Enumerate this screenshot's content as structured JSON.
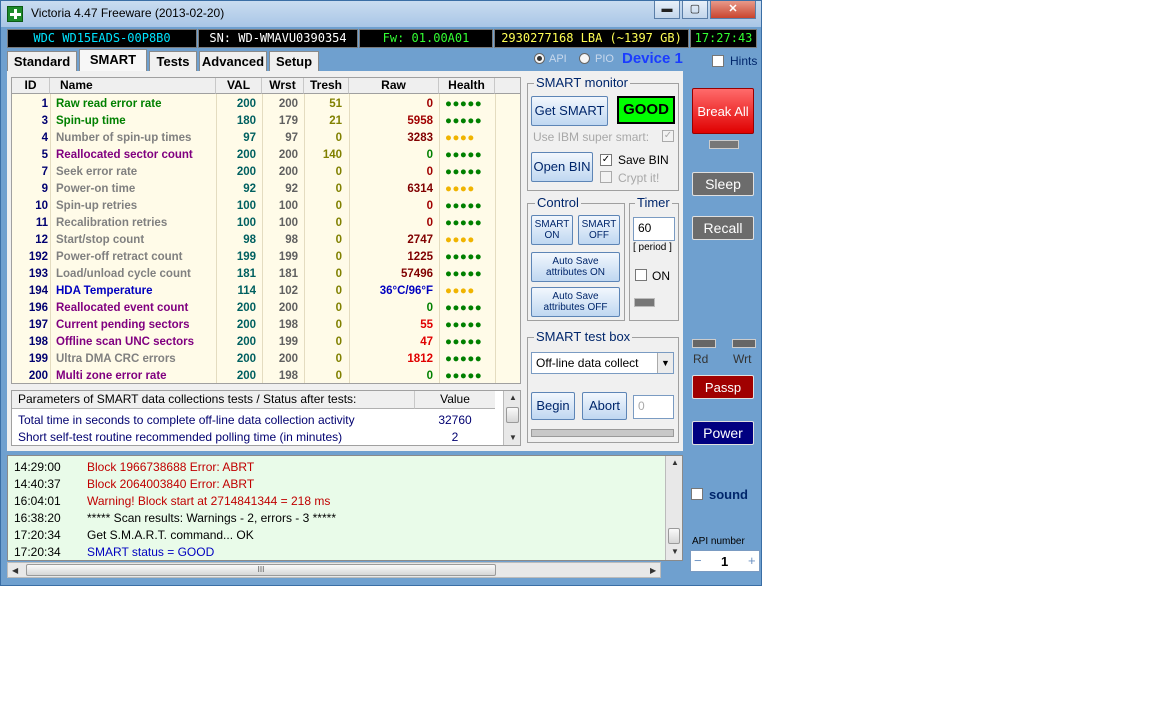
{
  "window": {
    "title": "Victoria 4.47  Freeware (2013-02-20)",
    "min_label": "▬",
    "max_label": "▢",
    "close_label": "✕"
  },
  "info": {
    "model": "WDC WD15EADS-00P8B0",
    "serial": "SN: WD-WMAVU0390354",
    "firmware": "Fw: 01.00A01",
    "lba": "2930277168 LBA (~1397 GB)",
    "clock": "17:27:43"
  },
  "tabs": [
    {
      "label": "Standard"
    },
    {
      "label": "SMART"
    },
    {
      "label": "Tests"
    },
    {
      "label": "Advanced"
    },
    {
      "label": "Setup"
    }
  ],
  "mode": {
    "api_label": "API",
    "pio_label": "PIO",
    "device_label": "Device 1",
    "hints_label": "Hints"
  },
  "smart_table": {
    "headers": {
      "id": "ID",
      "name": "Name",
      "val": "VAL",
      "wrst": "Wrst",
      "tresh": "Tresh",
      "raw": "Raw",
      "health": "Health"
    },
    "rows": [
      {
        "id": "1",
        "name": "Raw read error rate",
        "val": "200",
        "wrst": "200",
        "tresh": "51",
        "raw": "0",
        "health": "●●●●●",
        "name_color": "#008000",
        "raw_color": "#a00000",
        "health_color": "#008000"
      },
      {
        "id": "3",
        "name": "Spin-up time",
        "val": "180",
        "wrst": "179",
        "tresh": "21",
        "raw": "5958",
        "health": "●●●●●",
        "name_color": "#008000",
        "raw_color": "#a00000",
        "health_color": "#008000"
      },
      {
        "id": "4",
        "name": "Number of spin-up times",
        "val": "97",
        "wrst": "97",
        "tresh": "0",
        "raw": "3283",
        "health": "●●●●",
        "name_color": "#808080",
        "raw_color": "#800000",
        "health_color": "#f0b400"
      },
      {
        "id": "5",
        "name": "Reallocated sector count",
        "val": "200",
        "wrst": "200",
        "tresh": "140",
        "raw": "0",
        "health": "●●●●●",
        "name_color": "#800080",
        "raw_color": "#008000",
        "health_color": "#008000"
      },
      {
        "id": "7",
        "name": "Seek error rate",
        "val": "200",
        "wrst": "200",
        "tresh": "0",
        "raw": "0",
        "health": "●●●●●",
        "name_color": "#808080",
        "raw_color": "#a00000",
        "health_color": "#008000"
      },
      {
        "id": "9",
        "name": "Power-on time",
        "val": "92",
        "wrst": "92",
        "tresh": "0",
        "raw": "6314",
        "health": "●●●●",
        "name_color": "#808080",
        "raw_color": "#800000",
        "health_color": "#f0b400"
      },
      {
        "id": "10",
        "name": "Spin-up retries",
        "val": "100",
        "wrst": "100",
        "tresh": "0",
        "raw": "0",
        "health": "●●●●●",
        "name_color": "#808080",
        "raw_color": "#a00000",
        "health_color": "#008000"
      },
      {
        "id": "11",
        "name": "Recalibration retries",
        "val": "100",
        "wrst": "100",
        "tresh": "0",
        "raw": "0",
        "health": "●●●●●",
        "name_color": "#808080",
        "raw_color": "#a00000",
        "health_color": "#008000"
      },
      {
        "id": "12",
        "name": "Start/stop count",
        "val": "98",
        "wrst": "98",
        "tresh": "0",
        "raw": "2747",
        "health": "●●●●",
        "name_color": "#808080",
        "raw_color": "#800000",
        "health_color": "#f0b400"
      },
      {
        "id": "192",
        "name": "Power-off retract count",
        "val": "199",
        "wrst": "199",
        "tresh": "0",
        "raw": "1225",
        "health": "●●●●●",
        "name_color": "#808080",
        "raw_color": "#800000",
        "health_color": "#008000"
      },
      {
        "id": "193",
        "name": "Load/unload cycle count",
        "val": "181",
        "wrst": "181",
        "tresh": "0",
        "raw": "57496",
        "health": "●●●●●",
        "name_color": "#808080",
        "raw_color": "#800000",
        "health_color": "#008000"
      },
      {
        "id": "194",
        "name": "HDA Temperature",
        "val": "114",
        "wrst": "102",
        "tresh": "0",
        "raw": "36°C/96°F",
        "health": "●●●●",
        "name_color": "#0000c0",
        "raw_color": "#0000c0",
        "health_color": "#f0b400"
      },
      {
        "id": "196",
        "name": "Reallocated event count",
        "val": "200",
        "wrst": "200",
        "tresh": "0",
        "raw": "0",
        "health": "●●●●●",
        "name_color": "#800080",
        "raw_color": "#008000",
        "health_color": "#008000"
      },
      {
        "id": "197",
        "name": "Current pending sectors",
        "val": "200",
        "wrst": "198",
        "tresh": "0",
        "raw": "55",
        "health": "●●●●●",
        "name_color": "#800080",
        "raw_color": "#e00000",
        "health_color": "#008000"
      },
      {
        "id": "198",
        "name": "Offline scan UNC sectors",
        "val": "200",
        "wrst": "199",
        "tresh": "0",
        "raw": "47",
        "health": "●●●●●",
        "name_color": "#800080",
        "raw_color": "#e00000",
        "health_color": "#008000"
      },
      {
        "id": "199",
        "name": "Ultra DMA CRC errors",
        "val": "200",
        "wrst": "200",
        "tresh": "0",
        "raw": "1812",
        "health": "●●●●●",
        "name_color": "#808080",
        "raw_color": "#e00000",
        "health_color": "#008000"
      },
      {
        "id": "200",
        "name": "Multi zone error rate",
        "val": "200",
        "wrst": "198",
        "tresh": "0",
        "raw": "0",
        "health": "●●●●●",
        "name_color": "#800080",
        "raw_color": "#008000",
        "health_color": "#008000"
      }
    ]
  },
  "params": {
    "header_label": "Parameters of SMART data collections tests / Status after tests:",
    "header_value": "Value",
    "rows": [
      {
        "label": "Total time in seconds to complete off-line data collection activity",
        "value": "32760"
      },
      {
        "label": "Short self-test routine recommended polling time (in minutes)",
        "value": "2"
      }
    ]
  },
  "smart_monitor": {
    "title": "SMART monitor",
    "get_smart_label": "Get SMART",
    "status": "GOOD",
    "ibm_label": "Use IBM super smart:",
    "open_bin_label": "Open BIN",
    "save_bin_label": "Save BIN",
    "crypt_label": "Crypt it!"
  },
  "control": {
    "title": "Control",
    "smart_on_label": "SMART ON",
    "smart_off_label": "SMART OFF",
    "autosave_on_label": "Auto Save attributes ON",
    "autosave_off_label": "Auto Save attributes OFF"
  },
  "timer": {
    "title": "Timer",
    "value": "60",
    "period_label": "[ period ]",
    "on_label": "ON"
  },
  "test_box": {
    "title": "SMART test box",
    "selected": "Off-line data collect",
    "begin_label": "Begin",
    "abort_label": "Abort",
    "value": "0"
  },
  "side": {
    "break_all_label": "Break All",
    "sleep_label": "Sleep",
    "recall_label": "Recall",
    "rd_label": "Rd",
    "wrt_label": "Wrt",
    "passp_label": "Passp",
    "power_label": "Power",
    "sound_label": "sound",
    "api_number_label": "API number",
    "api_number_value": "1",
    "minus_label": "−",
    "plus_label": "+"
  },
  "log": [
    {
      "time": "14:29:00",
      "msg": "Block 1966738688 Error: ABRT",
      "color": "#c00000"
    },
    {
      "time": "14:40:37",
      "msg": "Block 2064003840 Error: ABRT",
      "color": "#c00000"
    },
    {
      "time": "16:04:01",
      "msg": "Warning! Block start at 2714841344 = 218 ms",
      "color": "#c00000"
    },
    {
      "time": "16:38:20",
      "msg": "***** Scan results: Warnings - 2, errors - 3 *****",
      "color": "#000000"
    },
    {
      "time": "17:20:34",
      "msg": "Get S.M.A.R.T. command... OK",
      "color": "#000000"
    },
    {
      "time": "17:20:34",
      "msg": "SMART status = GOOD",
      "color": "#0000c0"
    }
  ],
  "scrollbar_grip": "III"
}
